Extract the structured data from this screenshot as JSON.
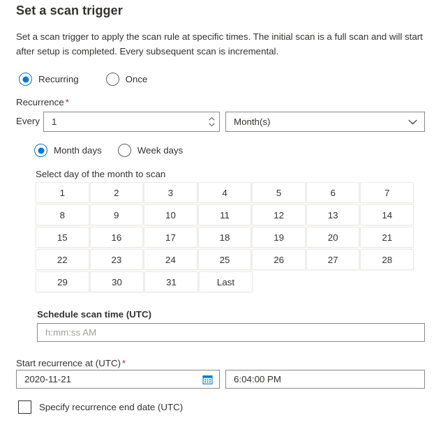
{
  "header": {
    "title": "Set a scan trigger",
    "description": "Set a scan trigger to apply the scan rule at specific times. The initial scan is a full scan and will start after setup is completed. Every subsequent scan is incremental."
  },
  "trigger_type": {
    "recurring_label": "Recurring",
    "once_label": "Once",
    "selected": "Recurring"
  },
  "recurrence": {
    "label": "Recurrence",
    "required_mark": "*",
    "every_label": "Every",
    "every_value": "1",
    "unit_value": "Month(s)"
  },
  "day_mode": {
    "month_days_label": "Month days",
    "week_days_label": "Week days",
    "selected": "Month days"
  },
  "day_picker": {
    "label": "Select day of the month to scan",
    "rows": [
      [
        "1",
        "2",
        "3",
        "4",
        "5",
        "6",
        "7"
      ],
      [
        "8",
        "9",
        "10",
        "11",
        "12",
        "13",
        "14"
      ],
      [
        "15",
        "16",
        "17",
        "18",
        "19",
        "20",
        "21"
      ],
      [
        "22",
        "23",
        "24",
        "25",
        "26",
        "27",
        "28"
      ],
      [
        "29",
        "30",
        "31",
        "Last"
      ]
    ]
  },
  "scan_time": {
    "label": "Schedule scan time (UTC)",
    "placeholder": "h:mm:ss AM",
    "value": ""
  },
  "start_recurrence": {
    "label": "Start recurrence at (UTC)",
    "required_mark": "*",
    "date_value": "2020-11-21",
    "time_value": "6:04:00 PM"
  },
  "end_date": {
    "label": "Specify recurrence end date (UTC)",
    "checked": false
  },
  "colors": {
    "accent": "#0078d4",
    "text": "#323130",
    "required": "#a4262c",
    "border": "#8a8886",
    "placeholder": "#a19f9d"
  }
}
